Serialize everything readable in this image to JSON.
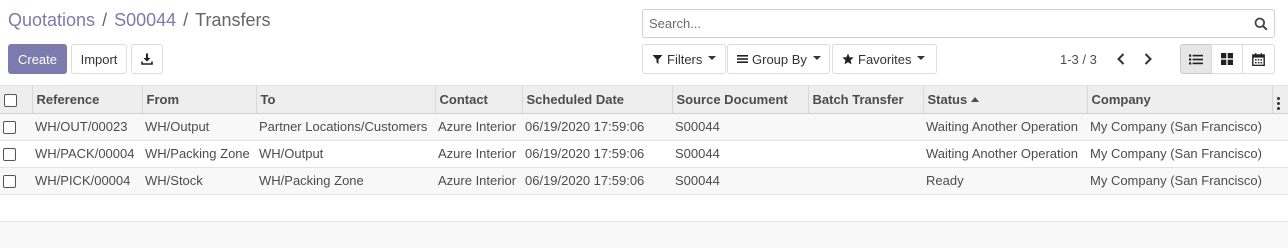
{
  "breadcrumb": {
    "items": [
      "Quotations",
      "S00044"
    ],
    "current": "Transfers",
    "separator": "/"
  },
  "buttons": {
    "create": "Create",
    "import": "Import",
    "download_icon": "download-icon"
  },
  "search": {
    "placeholder": "Search...",
    "value": ""
  },
  "filters": {
    "filters_label": "Filters",
    "group_by_label": "Group By",
    "favorites_label": "Favorites"
  },
  "pager": {
    "value": "1-3 / 3"
  },
  "views": [
    "list",
    "kanban",
    "calendar"
  ],
  "active_view": "list",
  "table": {
    "columns": [
      "Reference",
      "From",
      "To",
      "Contact",
      "Scheduled Date",
      "Source Document",
      "Batch Transfer",
      "Status",
      "Company"
    ],
    "sorted_column": "Status",
    "rows": [
      {
        "reference": "WH/OUT/00023",
        "from": "WH/Output",
        "to": "Partner Locations/Customers",
        "contact": "Azure Interior",
        "scheduled_date": "06/19/2020 17:59:06",
        "source_document": "S00044",
        "batch_transfer": "",
        "status": "Waiting Another Operation",
        "company": "My Company (San Francisco)"
      },
      {
        "reference": "WH/PACK/00004",
        "from": "WH/Packing Zone",
        "to": "WH/Output",
        "contact": "Azure Interior",
        "scheduled_date": "06/19/2020 17:59:06",
        "source_document": "S00044",
        "batch_transfer": "",
        "status": "Waiting Another Operation",
        "company": "My Company (San Francisco)"
      },
      {
        "reference": "WH/PICK/00004",
        "from": "WH/Stock",
        "to": "WH/Packing Zone",
        "contact": "Azure Interior",
        "scheduled_date": "06/19/2020 17:59:06",
        "source_document": "S00044",
        "batch_transfer": "",
        "status": "Ready",
        "company": "My Company (San Francisco)"
      }
    ]
  },
  "colors": {
    "primary": "#7c7bad",
    "header_bg": "#eeeeee",
    "text": "#4c4c4c"
  }
}
